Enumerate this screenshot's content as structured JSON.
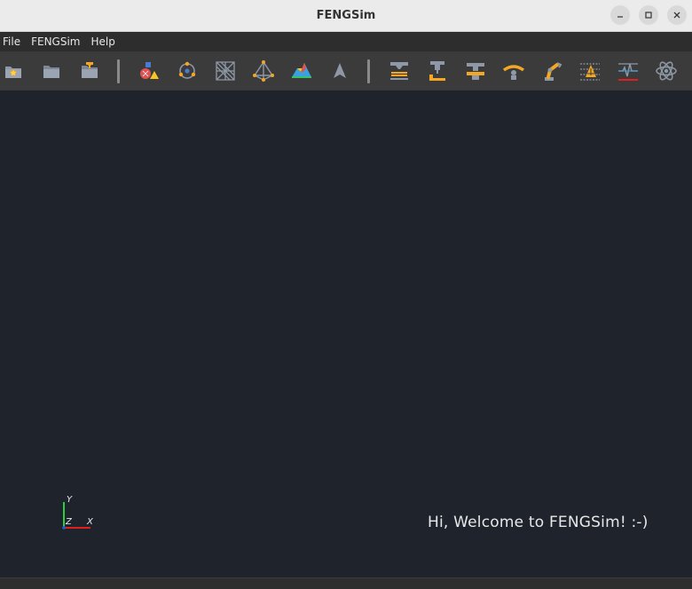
{
  "window": {
    "title": "FENGSim",
    "buttons": {
      "minimize": "–",
      "maximize": "□",
      "close": "×"
    }
  },
  "menubar": {
    "items": [
      {
        "label": "File"
      },
      {
        "label": "FENGSim"
      },
      {
        "label": "Help"
      }
    ]
  },
  "toolbar": {
    "icons": [
      "new-file-icon",
      "open-folder-icon",
      "save-folder-icon",
      "cad-shapes-icon",
      "molecule-icon",
      "mesh-icon",
      "polyhedron-icon",
      "surface-plot-icon",
      "navigation-arrow-icon",
      "additive-manufacturing-icon",
      "cnc-machining-icon",
      "press-icon",
      "bending-icon",
      "robot-arm-icon",
      "measurement-icon",
      "signal-icon",
      "atom-icon"
    ]
  },
  "viewport": {
    "background": "#1f242c",
    "axes": {
      "x_label": "X",
      "y_label": "Y",
      "z_label": "Z"
    },
    "welcome_text": "Hi, Welcome to FENGSim! :-)"
  },
  "colors": {
    "accent_orange": "#f5a623",
    "axis_x": "#e02020",
    "axis_y": "#2ecc40",
    "axis_z": "#1e5bd6",
    "icon_gray": "#8e98a6"
  }
}
